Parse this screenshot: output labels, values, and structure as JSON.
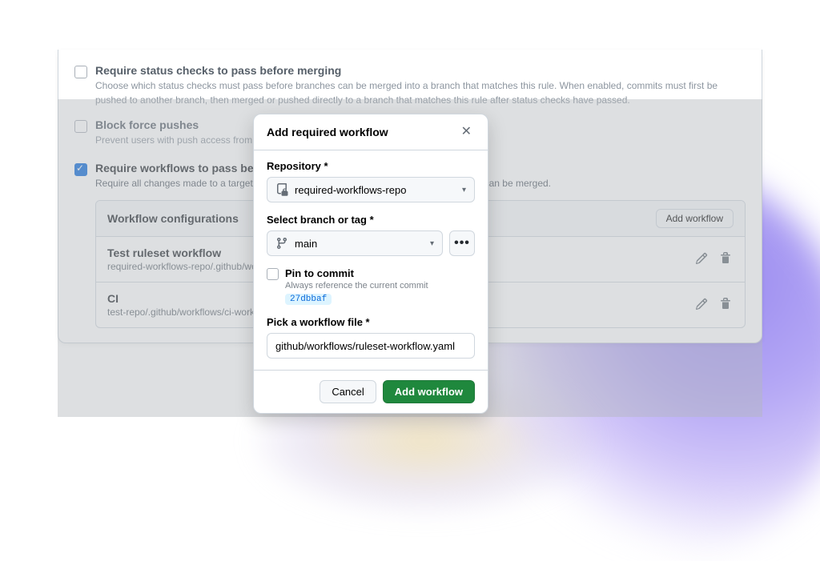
{
  "rules": {
    "status_checks": {
      "title": "Require status checks to pass before merging",
      "desc": "Choose which status checks must pass before branches can be merged into a branch that matches this rule. When enabled, commits must first be pushed to another branch, then merged or pushed directly to a branch that matches this rule after status checks have passed."
    },
    "block_force": {
      "title": "Block force pushes",
      "desc": "Prevent users with push access from force pushing to refs."
    },
    "require_workflows": {
      "title": "Require workflows to pass before merging",
      "desc": "Require all changes made to a targeted branch to pass the specified workflows before they can be merged."
    }
  },
  "workflow_box": {
    "header": "Workflow configurations",
    "add_label": "Add workflow",
    "rows": [
      {
        "name": "Test ruleset workflow",
        "path": "required-workflows-repo/.github/workflows/ruleset-workflow.yaml"
      },
      {
        "name": "CI",
        "path": "test-repo/.github/workflows/ci-workflow.yaml"
      }
    ]
  },
  "modal": {
    "title": "Add required workflow",
    "repo_label": "Repository *",
    "repo_value": "required-workflows-repo",
    "branch_label": "Select branch or tag *",
    "branch_value": "main",
    "pin_title": "Pin to commit",
    "pin_desc": "Always reference the current commit",
    "pin_commit": "27dbbaf",
    "file_label": "Pick a workflow file *",
    "file_value": "github/workflows/ruleset-workflow.yaml",
    "cancel": "Cancel",
    "submit": "Add workflow",
    "kebab": "•••"
  }
}
